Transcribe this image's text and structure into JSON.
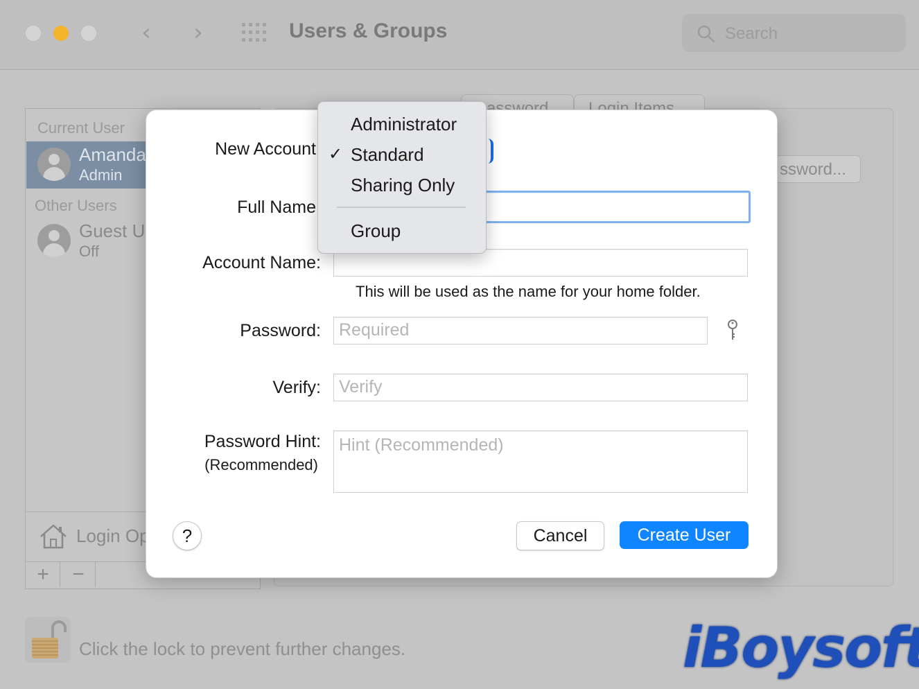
{
  "window": {
    "title": "Users & Groups",
    "traffic_colors": {
      "close": "#d4d4d4",
      "minimize": "#f4b42b",
      "zoom": "#d4d4d4"
    },
    "back_glyph": "‹",
    "forward_glyph": "›",
    "grid_icon": "grid-icon",
    "search_placeholder": "Search"
  },
  "sidebar": {
    "current_user_label": "Current User",
    "current_user": {
      "name": "Amanda",
      "role": "Admin"
    },
    "other_users_label": "Other Users",
    "guest": {
      "name": "Guest U",
      "status": "Off"
    },
    "login_options": "Login Op",
    "add": "+",
    "remove": "−"
  },
  "background_pane": {
    "tabs": [
      "Password",
      "Login Items"
    ],
    "change_password_button": "ssword..."
  },
  "lock": {
    "text": "Click the lock to prevent further changes."
  },
  "watermark": "iBoysoft",
  "dialog": {
    "new_account_label": "New Account",
    "full_name_label": "Full Name",
    "full_name_value": "",
    "account_name_label": "Account Name:",
    "account_name_value": "",
    "account_name_note": "This will be used as the name for your home folder.",
    "password_label": "Password:",
    "password_placeholder": "Required",
    "verify_label": "Verify:",
    "verify_placeholder": "Verify",
    "hint_label": "Password Hint:",
    "hint_sublabel": "(Recommended)",
    "hint_placeholder": "Hint (Recommended)",
    "help": "?",
    "cancel": "Cancel",
    "create": "Create User",
    "accent": "#0f86ff"
  },
  "account_type_menu": {
    "items": [
      "Administrator",
      "Standard",
      "Sharing Only",
      "Group"
    ],
    "selected": "Standard",
    "check_glyph": "✓"
  }
}
